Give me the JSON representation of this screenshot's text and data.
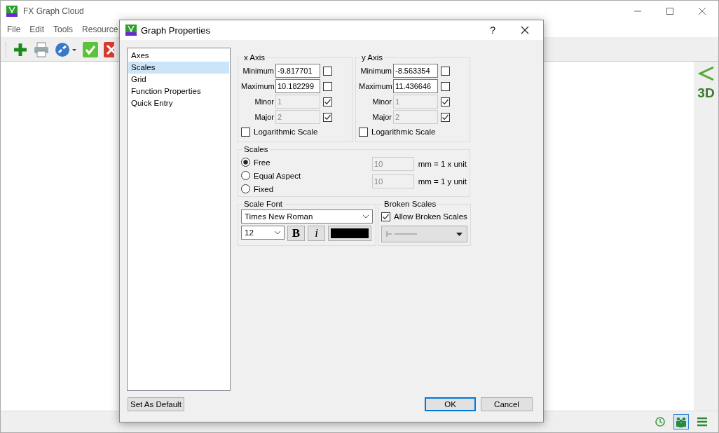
{
  "window": {
    "title": "FX Graph Cloud"
  },
  "menu": [
    "File",
    "Edit",
    "Tools",
    "Resource"
  ],
  "side_panel": {
    "mode_label": "3D"
  },
  "status_buttons": [
    {
      "selected": false
    },
    {
      "selected": true
    },
    {
      "selected": false
    }
  ],
  "dialog": {
    "title": "Graph Properties",
    "help": "?",
    "categories": [
      {
        "label": "Axes",
        "selected": false
      },
      {
        "label": "Scales",
        "selected": true
      },
      {
        "label": "Grid",
        "selected": false
      },
      {
        "label": "Function Properties",
        "selected": false
      },
      {
        "label": "Quick Entry",
        "selected": false
      }
    ],
    "axes": [
      {
        "title": "x Axis",
        "fields": [
          {
            "label": "Minimum",
            "value": "-9.817701",
            "disabled": false,
            "checked": false
          },
          {
            "label": "Maximum",
            "value": "10.182299",
            "disabled": false,
            "checked": false
          },
          {
            "label": "Minor",
            "value": "1",
            "disabled": true,
            "checked": true
          },
          {
            "label": "Major",
            "value": "2",
            "disabled": true,
            "checked": true
          }
        ],
        "log": {
          "label": "Logarithmic Scale",
          "checked": false
        }
      },
      {
        "title": "y Axis",
        "fields": [
          {
            "label": "Minimum",
            "value": "-8.563354",
            "disabled": false,
            "checked": false
          },
          {
            "label": "Maximum",
            "value": "11.436646",
            "disabled": false,
            "checked": false
          },
          {
            "label": "Minor",
            "value": "1",
            "disabled": true,
            "checked": true
          },
          {
            "label": "Major",
            "value": "2",
            "disabled": true,
            "checked": true
          }
        ],
        "log": {
          "label": "Logarithmic Scale",
          "checked": false
        }
      }
    ],
    "scales": {
      "title": "Scales",
      "options": [
        {
          "label": "Free",
          "selected": true
        },
        {
          "label": "Equal Aspect",
          "selected": false
        },
        {
          "label": "Fixed",
          "selected": false
        }
      ],
      "units": [
        {
          "value": "10",
          "label": "mm = 1 x unit",
          "disabled": true
        },
        {
          "value": "10",
          "label": "mm = 1 y unit",
          "disabled": true
        }
      ]
    },
    "scale_font": {
      "title": "Scale Font",
      "font": "Times New Roman",
      "size": "12",
      "bold": "B",
      "italic": "i",
      "color": "#000000"
    },
    "broken_scales": {
      "title": "Broken Scales",
      "label": "Allow Broken Scales",
      "checked": true
    },
    "buttons": {
      "default": "Set As Default",
      "ok": "OK",
      "cancel": "Cancel"
    }
  }
}
